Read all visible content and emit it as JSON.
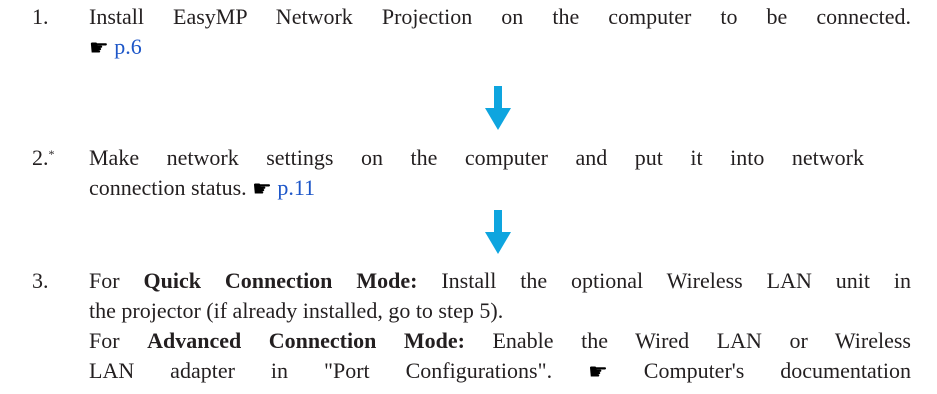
{
  "steps": [
    {
      "number": "1.",
      "line1": "Install EasyMP Network Projection on the computer to be connected.",
      "ref_icon": "pointing-hand-icon",
      "ref_link": "p.6"
    },
    {
      "number": "2.",
      "footnote_mark": "*",
      "line1": "Make network settings on the computer and put it into network",
      "line2_text": "connection status.",
      "ref_icon": "pointing-hand-icon",
      "ref_link": "p.11"
    },
    {
      "number": "3.",
      "quick_prefix": "For",
      "quick_bold": "Quick Connection Mode:",
      "quick_line1_rest": "Install the optional Wireless LAN unit in",
      "quick_line2": "the projector (if already installed, go to step 5).",
      "advanced_prefix": "For",
      "advanced_bold": "Advanced Connection Mode:",
      "advanced_line1_rest": "Enable the Wired LAN or Wireless",
      "advanced_line2": "LAN adapter in \"Port Configurations\".",
      "ref_icon": "pointing-hand-icon",
      "ref_text": "Computer's documentation"
    }
  ],
  "arrow_color": "#0ea5df",
  "link_color": "#1d56c8",
  "hand_glyph": "☛"
}
